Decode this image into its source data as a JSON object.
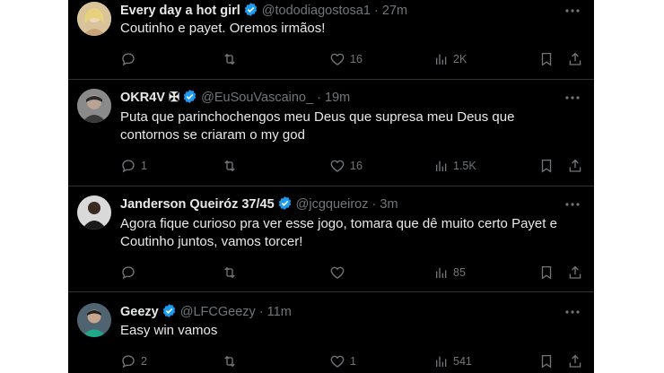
{
  "tweets": [
    {
      "name": "Every day a hot girl",
      "handle": "@tododiagostosa1",
      "separator": "·",
      "time": "27m",
      "lines": [
        "Coutinho e payet. Oremos irmãos!"
      ],
      "replies": "",
      "retweets": "",
      "likes": "16",
      "views": "2K",
      "avatar_color": "#c9b48a"
    },
    {
      "name": "OKR4V",
      "name_suffix": "✠",
      "handle": "@EuSouVascaino_",
      "separator": "·",
      "time": "19m",
      "lines": [
        "Puta que parinchochengos meu Deus que supresa meu Deus que",
        "contornos se criaram o my god"
      ],
      "replies": "1",
      "retweets": "",
      "likes": "16",
      "views": "1.5K",
      "avatar_color": "#6a6a6a"
    },
    {
      "name": "Janderson Queiróz 37/45",
      "handle": "@jcgqueiroz",
      "separator": "·",
      "time": "3m",
      "lines": [
        "Agora fique curioso pra ver esse jogo, tomara que dê muito certo Payet e",
        "Coutinho juntos, vamos torcer!"
      ],
      "replies": "",
      "retweets": "",
      "likes": "",
      "views": "85",
      "avatar_color": "#2a2a2a"
    },
    {
      "name": "Geezy",
      "handle": "@LFCGeezy",
      "separator": "·",
      "time": "11m",
      "lines": [
        "Easy win vamos"
      ],
      "replies": "2",
      "retweets": "",
      "likes": "1",
      "views": "541",
      "avatar_color": "#3d4a52"
    }
  ],
  "colors": {
    "background": "#000000",
    "text": "#e7e9ea",
    "muted": "#71767b",
    "verified": "#1d9bf0",
    "separator": "#2f3336"
  },
  "icons": [
    "verified-badge-icon",
    "more-options-icon",
    "reply-icon",
    "retweet-icon",
    "like-icon",
    "views-icon",
    "bookmark-icon",
    "share-icon"
  ]
}
